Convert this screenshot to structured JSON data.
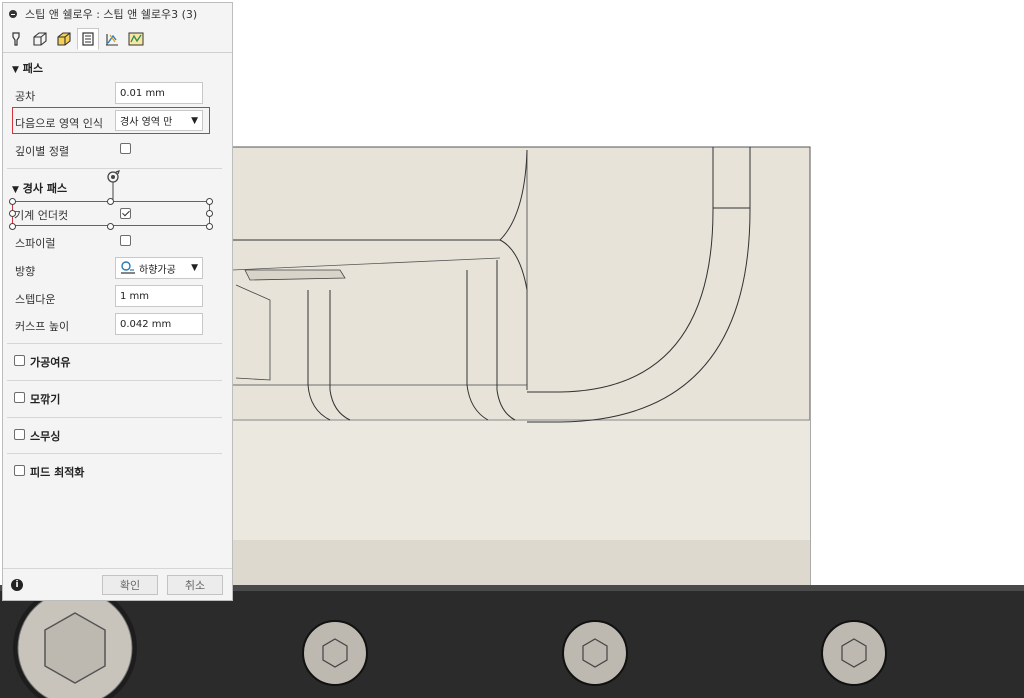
{
  "window": {
    "title": "스팁 앤 쉘로우 : 스팁 앤 쉘로우3 (3)"
  },
  "tabs": [
    {
      "name": "tool",
      "icon": "tool-icon"
    },
    {
      "name": "geometry",
      "icon": "geometry-icon"
    },
    {
      "name": "heights",
      "icon": "heights-icon"
    },
    {
      "name": "passes",
      "icon": "passes-icon",
      "active": true
    },
    {
      "name": "linking",
      "icon": "linking-icon"
    },
    {
      "name": "simulation",
      "icon": "simulation-icon"
    }
  ],
  "passes": {
    "header": "패스",
    "tolerance_label": "공차",
    "tolerance_value": "0.01 mm",
    "region_label": "다음으로 영역 인식",
    "region_value": "경사 영역 만",
    "depth_sort_label": "깊이별 정렬"
  },
  "steep_passes": {
    "header": "경사 패스",
    "machine_undercut_label": "기계 언더컷",
    "spiral_label": "스파이럴",
    "direction_label": "방향",
    "direction_value": "하향가공",
    "stepdown_label": "스텝다운",
    "stepdown_value": "1 mm",
    "cusp_label": "커스프 높이",
    "cusp_value": "0.042 mm"
  },
  "sections": {
    "stock_to_leave": "가공여유",
    "fillet": "모깎기",
    "smoothing": "스무싱",
    "feed_optimization": "피드 최적화"
  },
  "footer": {
    "ok_label": "확인",
    "cancel_label": "취소"
  },
  "colors": {
    "highlight": "#d1343b",
    "model": "#e6e2d8",
    "fixture": "#2b2b2b"
  }
}
